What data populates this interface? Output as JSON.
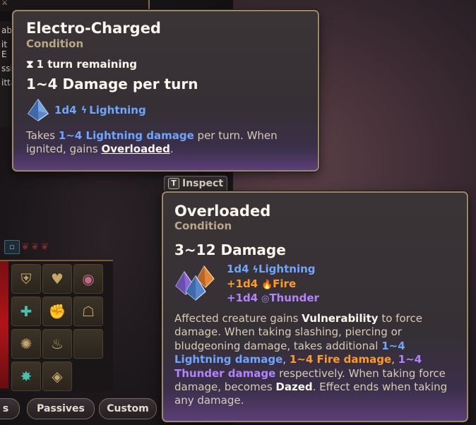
{
  "hotbar": {
    "top_button_icon": "square-icon",
    "tabs": [
      {
        "label": "s"
      },
      {
        "label": "Passives"
      },
      {
        "label": "Custom"
      }
    ],
    "slots": [
      {
        "icon": "shield-emblem-icon"
      },
      {
        "icon": "heart-hands-icon"
      },
      {
        "icon": "eye-icon"
      },
      {
        "icon": "cross-icon"
      },
      {
        "icon": "fist-icon"
      },
      {
        "icon": "mask-icon"
      },
      {
        "icon": "claw-burst-icon"
      },
      {
        "icon": "flame-icon"
      },
      {
        "icon": "empty-slot-icon"
      },
      {
        "icon": "sparkle-icon"
      },
      {
        "icon": "rune-icon"
      }
    ]
  },
  "side_fragments": [
    "ab",
    "it E",
    "ssio",
    "itta"
  ],
  "tooltip_electro": {
    "title": "Electro-Charged",
    "subtitle": "Condition",
    "turns": "1 turn remaining",
    "damage": "1~4 Damage per turn",
    "dice": "1d4",
    "damage_type": "Lightning",
    "desc_pre": "Takes ",
    "desc_hl": "1~4 Lightning damage",
    "desc_mid": " per turn. When ignited, gains ",
    "desc_link": "Overloaded",
    "desc_end": "."
  },
  "inspect": {
    "key": "T",
    "label": "Inspect"
  },
  "tooltip_overloaded": {
    "title": "Overloaded",
    "subtitle": "Condition",
    "damage": "3~12 Damage",
    "dice": [
      {
        "text": "1d4",
        "type": "Lightning",
        "color": "#6ea6ff"
      },
      {
        "text": "+1d4",
        "type": "Fire",
        "color": "#ff9a2a"
      },
      {
        "text": "+1d4",
        "type": "Thunder",
        "color": "#b283ff"
      }
    ],
    "desc": {
      "p1": "Affected creature gains ",
      "vuln": "Vulnerability",
      "p2": " to force damage. When taking slashing, piercing or bludgeoning damage, takes additional ",
      "light": "1~4 Lightning damage",
      "sep1": ", ",
      "fire": "1~4 Fire damage",
      "sep2": ", ",
      "thunder": "1~4 Thunder damage",
      "p3": " respectively. When taking force damage, becomes ",
      "dazed": "Dazed",
      "p4": ". Effect ends when taking any damage."
    }
  }
}
